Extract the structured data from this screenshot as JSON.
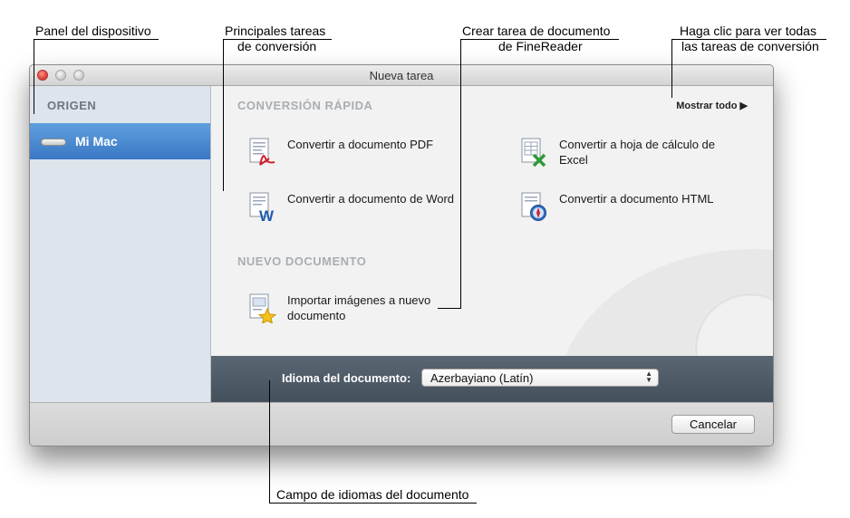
{
  "callouts": {
    "device_panel": "Panel del dispositivo",
    "main_tasks_line1": "Principales tareas",
    "main_tasks_line2": "de conversión",
    "create_task_line1": "Crear tarea de documento",
    "create_task_line2": "de FineReader",
    "show_all_line1": "Haga clic para ver todas",
    "show_all_line2": "las tareas de conversión",
    "language_field": "Campo de idiomas del documento"
  },
  "window": {
    "title": "Nueva tarea",
    "controls": [
      "close",
      "minimize",
      "zoom"
    ]
  },
  "sidebar": {
    "header": "ORIGEN",
    "items": [
      {
        "label": "Mi Mac",
        "icon": "mac-mini-icon",
        "selected": true
      }
    ]
  },
  "main": {
    "quick_section": "CONVERSIÓN RÁPIDA",
    "show_all": "Mostrar todo ▶",
    "quick_tasks": [
      {
        "label": "Convertir a documento PDF",
        "icon": "pdf-document-icon"
      },
      {
        "label": "Convertir a hoja de cálculo de Excel",
        "icon": "excel-document-icon"
      },
      {
        "label": "Convertir a documento de Word",
        "icon": "word-document-icon"
      },
      {
        "label": "Convertir a documento HTML",
        "icon": "html-document-icon"
      }
    ],
    "new_section": "NUEVO DOCUMENTO",
    "new_tasks": [
      {
        "label": "Importar imágenes a nuevo documento",
        "icon": "import-images-icon"
      }
    ]
  },
  "language": {
    "label": "Idioma del documento:",
    "selected": "Azerbayiano (Latín)"
  },
  "footer": {
    "cancel_label": "Cancelar"
  },
  "colors": {
    "selection": "#3f7fcb",
    "language_bar": "#4e5a66",
    "sidebar": "#dde4ec"
  }
}
